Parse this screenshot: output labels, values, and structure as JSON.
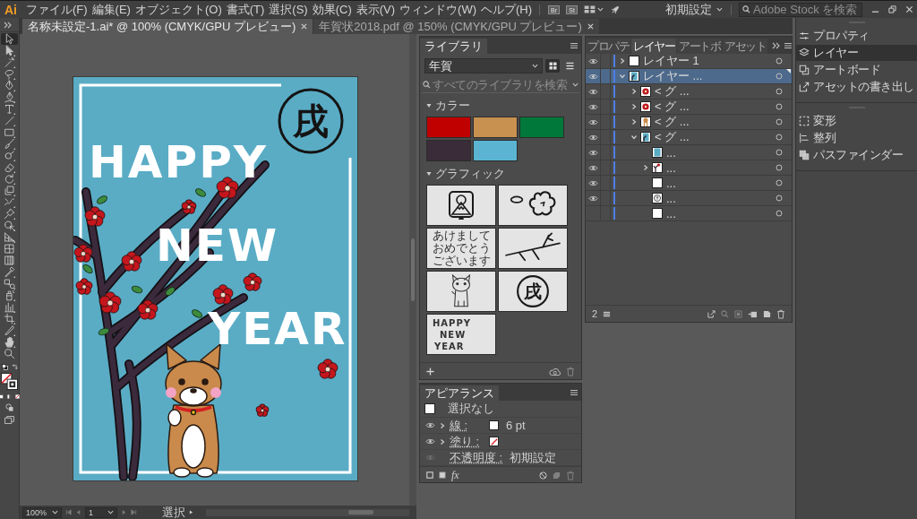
{
  "menubar": {
    "logo": "Ai",
    "menus": [
      "ファイル(F)",
      "編集(E)",
      "オブジェクト(O)",
      "書式(T)",
      "選択(S)",
      "効果(C)",
      "表示(V)",
      "ウィンドウ(W)",
      "ヘルプ(H)"
    ],
    "app_buttons": [
      "Br",
      "St"
    ],
    "workspace": "初期設定",
    "search": {
      "placeholder": "Adobe Stock を検索"
    }
  },
  "documents": [
    {
      "title": "名称未設定-1.ai* @ 100% (CMYK/GPU プレビュー)",
      "selected": true
    },
    {
      "title": "年賀状2018.pdf @ 150% (CMYK/GPU プレビュー)",
      "selected": false
    }
  ],
  "tools": [
    {
      "kind": "selection",
      "selected": true
    },
    {
      "kind": "direct-selection",
      "selected": false
    },
    {
      "kind": "magic-wand",
      "selected": false
    },
    {
      "kind": "lasso",
      "selected": false
    },
    {
      "kind": "pen",
      "selected": false
    },
    {
      "kind": "curvature",
      "selected": false
    },
    {
      "kind": "type",
      "selected": false
    },
    {
      "kind": "line-segment",
      "selected": false
    },
    {
      "kind": "rectangle",
      "selected": false
    },
    {
      "kind": "paintbrush",
      "selected": false
    },
    {
      "kind": "shaper",
      "selected": false
    },
    {
      "kind": "eraser",
      "selected": false
    },
    {
      "kind": "rotate",
      "selected": false
    },
    {
      "kind": "scale",
      "selected": false
    },
    {
      "kind": "warp",
      "selected": false
    },
    {
      "kind": "puppet-warp",
      "selected": false
    },
    {
      "kind": "shape-builder",
      "selected": false
    },
    {
      "kind": "perspective-grid",
      "selected": false
    },
    {
      "kind": "mesh",
      "selected": false
    },
    {
      "kind": "gradient",
      "selected": false
    },
    {
      "kind": "eyedropper",
      "selected": false
    },
    {
      "kind": "blend",
      "selected": false
    },
    {
      "kind": "symbol-sprayer",
      "selected": false
    },
    {
      "kind": "graph",
      "selected": false
    },
    {
      "kind": "artboard",
      "selected": false
    },
    {
      "kind": "slice",
      "selected": false
    },
    {
      "kind": "hand",
      "selected": false
    },
    {
      "kind": "zoom",
      "selected": false
    }
  ],
  "artboard": {
    "stamp": "戌",
    "lettering": [
      "HAPPY",
      "NEW",
      "YEAR"
    ]
  },
  "libraries": {
    "tab": "ライブラリ",
    "library": "年賀",
    "views": [
      {
        "kind": "grid",
        "selected": true
      },
      {
        "kind": "list",
        "selected": false
      }
    ],
    "search": {
      "placeholder": "すべてのライブラリを検索"
    },
    "colors": {
      "title": "カラー",
      "expanded": true,
      "swatches": [
        {
          "color": "#c00000"
        },
        {
          "color": "#c8914f"
        },
        {
          "color": "#00783a"
        },
        {
          "color": "#3a2c38"
        },
        {
          "color": "#5bb5d2"
        }
      ]
    },
    "graphics": {
      "title": "グラフィック",
      "expanded": true,
      "items": [
        {
          "kind": "mountain"
        },
        {
          "kind": "blossom"
        },
        {
          "kind": "greeting",
          "text": "あけましておめでとうございます"
        },
        {
          "kind": "branch"
        },
        {
          "kind": "dog"
        },
        {
          "kind": "stamp",
          "text": "戌"
        },
        {
          "kind": "lettering",
          "lines": [
            "HAPPY",
            "NEW",
            "YEAR"
          ]
        }
      ]
    }
  },
  "appearance": {
    "tab": "アピアランス",
    "selection": "選択なし",
    "rows": [
      {
        "label": "線 :",
        "eye_enabled": true,
        "expanded": false,
        "swatch_none": false,
        "value": "6 pt"
      },
      {
        "label": "塗り :",
        "eye_enabled": true,
        "expanded": false,
        "swatch_none": true
      },
      {
        "label": "不透明度 :",
        "eye_enabled": false,
        "value": "初期設定"
      }
    ],
    "effects_button": "fx"
  },
  "layers": {
    "tabs": [
      {
        "label": "プロパテ",
        "selected": false
      },
      {
        "label": "レイヤー",
        "selected": true
      },
      {
        "label": "アートボ",
        "selected": false
      },
      {
        "label": "アセット",
        "selected": false
      }
    ],
    "items": [
      {
        "kind": "blank",
        "name": "レイヤー 1",
        "visible": true,
        "selected": false,
        "expanded": false
      },
      {
        "kind": "artwork",
        "name": "レイヤー ...",
        "visible": true,
        "selected": true,
        "expanded": true,
        "children": [
          {
            "kind": "blossom",
            "name": "< グ ...",
            "visible": true,
            "selected": false,
            "expanded": false
          },
          {
            "kind": "blossom",
            "name": "< グ ...",
            "visible": true,
            "selected": false,
            "expanded": false
          },
          {
            "kind": "dog",
            "name": "< グ ...",
            "visible": true,
            "selected": false,
            "expanded": false
          },
          {
            "kind": "artwork",
            "name": "< グ ...",
            "visible": true,
            "selected": false,
            "expanded": true,
            "children": [
              {
                "kind": "rectangle",
                "name": "...",
                "visible": true,
                "selected": false
              },
              {
                "kind": "branch",
                "name": "...",
                "visible": true,
                "selected": false,
                "expanded": false
              },
              {
                "kind": "blank",
                "name": "...",
                "visible": true,
                "selected": false
              },
              {
                "kind": "stamp",
                "name": "...",
                "visible": true,
                "selected": false
              },
              {
                "kind": "blank",
                "name": "...",
                "visible": false,
                "selected": false
              }
            ]
          }
        ]
      }
    ],
    "count": "2"
  },
  "sidebar": {
    "groups": [
      {
        "items": [
          {
            "kind": "properties",
            "label": "プロパティ",
            "selected": false
          },
          {
            "kind": "layers",
            "label": "レイヤー",
            "selected": true
          },
          {
            "kind": "artboards",
            "label": "アートボード",
            "selected": false
          },
          {
            "kind": "export",
            "label": "アセットの書き出し",
            "selected": false
          }
        ]
      },
      {
        "items": [
          {
            "kind": "transform",
            "label": "変形",
            "selected": false
          },
          {
            "kind": "align",
            "label": "整列",
            "selected": false
          },
          {
            "kind": "pathfinder",
            "label": "パスファインダー",
            "selected": false
          }
        ]
      }
    ]
  },
  "status_bar": {
    "zoom": "100%",
    "artboard": "1",
    "tool": "選択"
  }
}
